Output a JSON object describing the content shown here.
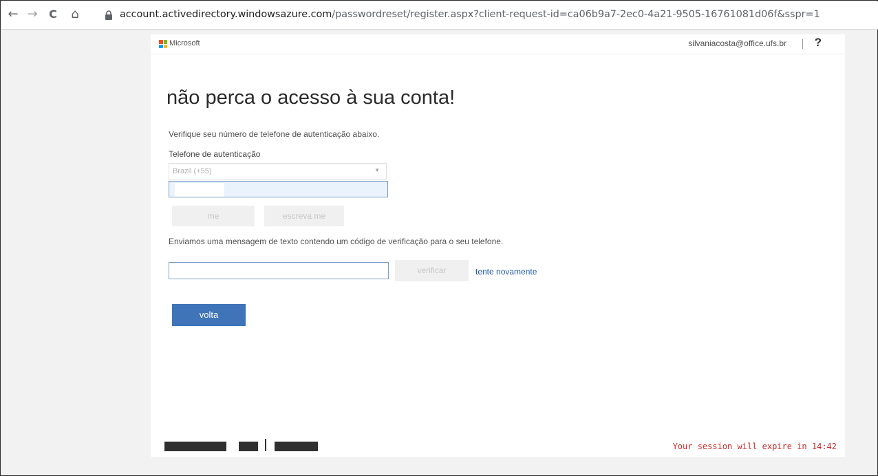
{
  "browser": {
    "back_glyph": "←",
    "forward_glyph": "→",
    "reload_glyph": "C",
    "home_glyph": "⌂",
    "url_host": "account.activedirectory.windowsazure.com",
    "url_path": "/passwordreset/register.aspx?client-request-id=ca06b9a7-2ec0-4a21-9505-16761081d06f&sspr=1"
  },
  "header": {
    "brand": "Microsoft",
    "user_email": "silvaniacosta@office.ufs.br",
    "help_glyph": "?",
    "logo_colors": [
      "#f25022",
      "#7fba00",
      "#00a4ef",
      "#ffb900"
    ]
  },
  "main": {
    "title": "não perca o acesso à sua conta!",
    "instructions": "Verifique seu número de telefone de autenticação abaixo.",
    "phone_label": "Telefone de autenticação",
    "country_value": "Brazil (+55)",
    "call_button": "me",
    "text_button": "escreva me",
    "sent_message": "Enviamos uma mensagem de texto contendo um código de verificação para o seu telefone.",
    "verify_button": "verificar",
    "retry_link": "tente novamente",
    "back_button": "volta"
  },
  "footer": {
    "session_note": "Your session will expire in 14:42"
  },
  "colors": {
    "primary_button": "#3f74b8",
    "link": "#1f5aa5",
    "session_warning": "#cf2b2b"
  }
}
